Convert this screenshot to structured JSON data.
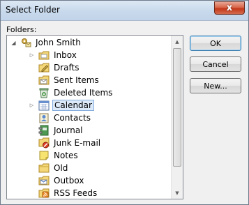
{
  "window": {
    "title": "Select Folder",
    "close_glyph": "x"
  },
  "folders_label": "Folders:",
  "tree": {
    "root": {
      "label": "John Smith",
      "icon": "mailbox-icon"
    },
    "items": [
      {
        "label": "Inbox",
        "icon": "inbox-icon",
        "expandable": true
      },
      {
        "label": "Drafts",
        "icon": "drafts-icon",
        "expandable": false
      },
      {
        "label": "Sent Items",
        "icon": "sent-items-icon",
        "expandable": false
      },
      {
        "label": "Deleted Items",
        "icon": "deleted-items-icon",
        "expandable": false
      },
      {
        "label": "Calendar",
        "icon": "calendar-icon",
        "expandable": true,
        "selected": true
      },
      {
        "label": "Contacts",
        "icon": "contacts-icon",
        "expandable": false
      },
      {
        "label": "Journal",
        "icon": "journal-icon",
        "expandable": false
      },
      {
        "label": "Junk E-mail",
        "icon": "junk-email-icon",
        "expandable": false
      },
      {
        "label": "Notes",
        "icon": "notes-icon",
        "expandable": false
      },
      {
        "label": "Old",
        "icon": "folder-icon",
        "expandable": false
      },
      {
        "label": "Outbox",
        "icon": "outbox-icon",
        "expandable": false
      },
      {
        "label": "RSS Feeds",
        "icon": "rss-icon",
        "expandable": false
      }
    ]
  },
  "buttons": {
    "ok": "OK",
    "cancel": "Cancel",
    "new": "New..."
  },
  "colors": {
    "selection_bg": "#dce9f8",
    "selection_border": "#84acdd",
    "default_button_border": "#3c7fb1"
  }
}
